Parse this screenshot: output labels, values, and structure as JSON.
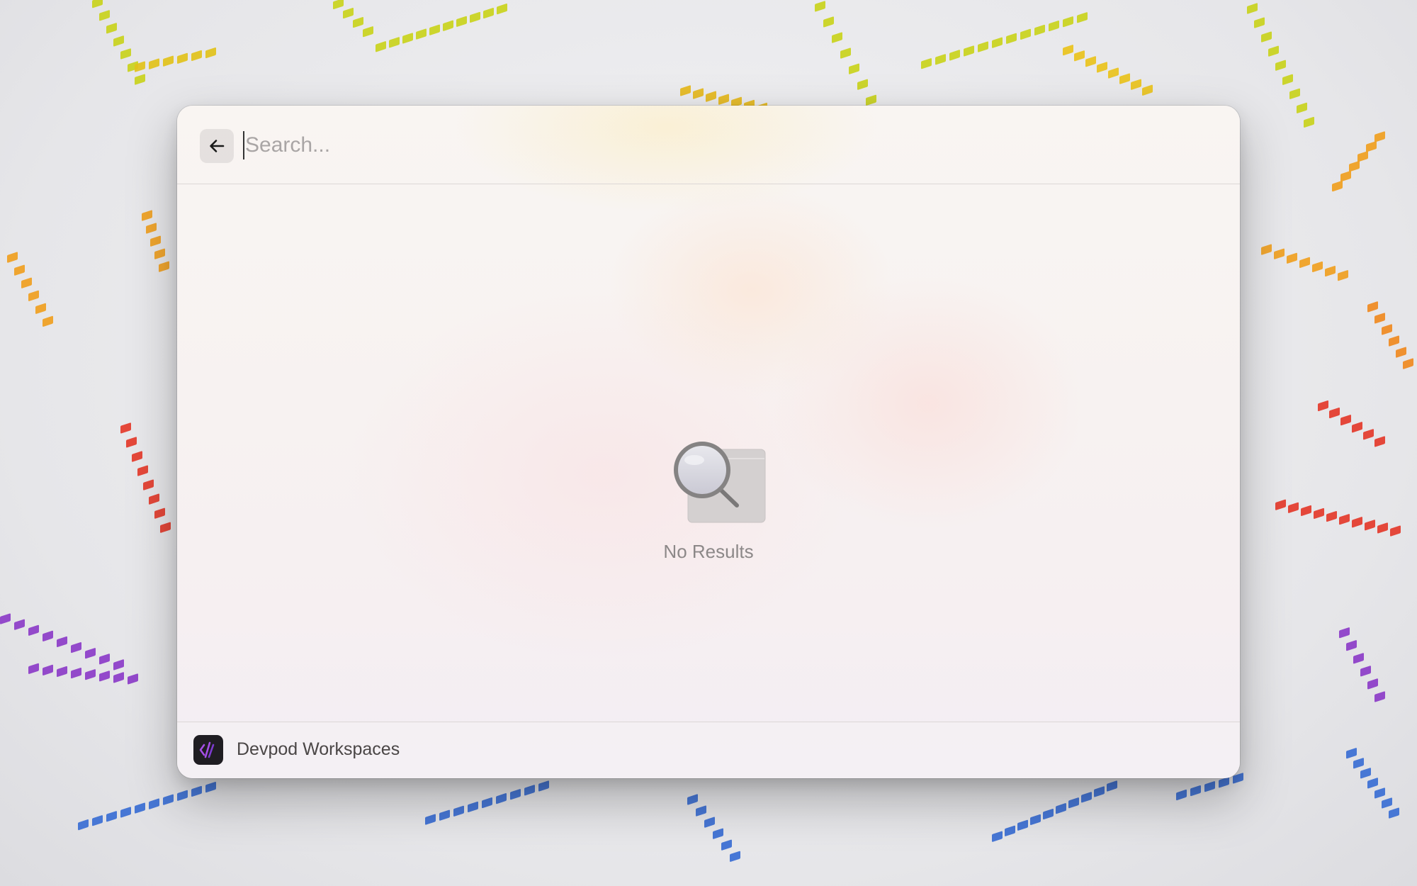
{
  "search": {
    "placeholder": "Search...",
    "value": ""
  },
  "empty_state": {
    "message": "No Results",
    "icon": "magnifier-over-window-icon"
  },
  "footer": {
    "extension_name": "Devpod Workspaces",
    "icon": "devpod-logo-icon"
  },
  "icons": {
    "back": "arrow-left-icon"
  },
  "colors": {
    "wallpaper_yellow": "#c9d21c",
    "wallpaper_orange": "#f0a020",
    "wallpaper_red": "#e43a2a",
    "wallpaper_purple": "#8c3cc8",
    "wallpaper_blue": "#3a6ed4",
    "devpod_accent": "#a54ee6"
  }
}
